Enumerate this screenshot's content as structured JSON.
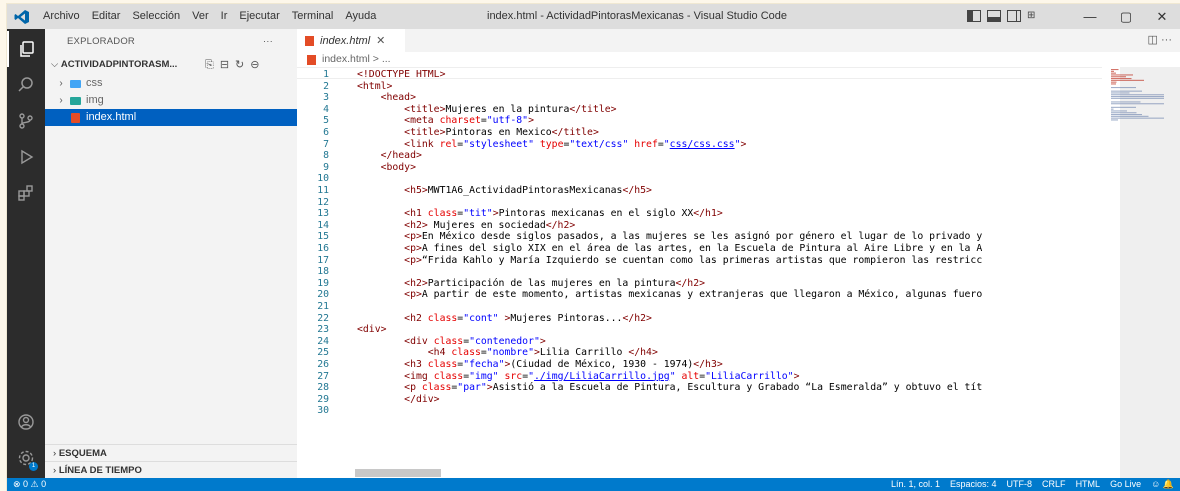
{
  "menu": [
    "Archivo",
    "Editar",
    "Selección",
    "Ver",
    "Ir",
    "Ejecutar",
    "Terminal",
    "Ayuda"
  ],
  "window_title": "index.html - ActividadPintorasMexicanas - Visual Studio Code",
  "window_controls": {
    "minimize": "—",
    "maximize": "▢",
    "close": "✕"
  },
  "sidebar": {
    "header": "EXPLORADOR",
    "more": "···",
    "project": "ACTIVIDADPINTORASM...",
    "items": [
      {
        "label": "css",
        "type": "folder",
        "color": "#42a5f5"
      },
      {
        "label": "img",
        "type": "folder",
        "color": "#26a69a"
      },
      {
        "label": "index.html",
        "type": "file"
      }
    ],
    "sections": [
      "ESQUEMA",
      "LÍNEA DE TIEMPO"
    ]
  },
  "editor": {
    "tab_label": "index.html",
    "tab_close": "✕",
    "breadcrumb": [
      "index.html",
      ">",
      "..."
    ],
    "tab_actions": "◫ ···"
  },
  "code_lines": [
    {
      "n": "1",
      "parts": [
        [
          "<!DOCTYPE HTML>",
          "t"
        ]
      ]
    },
    {
      "n": "2",
      "parts": [
        [
          "<html>",
          "t"
        ]
      ]
    },
    {
      "n": "3",
      "parts": [
        [
          "    <head>",
          "t"
        ]
      ]
    },
    {
      "n": "4",
      "parts": [
        [
          "        <title>",
          "t"
        ],
        [
          "Mujeres en la pintura",
          ""
        ],
        [
          "</title>",
          "t"
        ]
      ]
    },
    {
      "n": "5",
      "parts": [
        [
          "        <meta ",
          "t"
        ],
        [
          "charset",
          "a"
        ],
        [
          "=",
          ""
        ],
        [
          "\"utf-8\"",
          "v"
        ],
        [
          ">",
          "t"
        ]
      ]
    },
    {
      "n": "6",
      "parts": [
        [
          "        <title>",
          "t"
        ],
        [
          "Pintoras en Mexico",
          ""
        ],
        [
          "</title>",
          "t"
        ]
      ]
    },
    {
      "n": "7",
      "parts": [
        [
          "        <link ",
          "t"
        ],
        [
          "rel",
          "a"
        ],
        [
          "=",
          ""
        ],
        [
          "\"stylesheet\"",
          "v"
        ],
        [
          " ",
          ""
        ],
        [
          "type",
          "a"
        ],
        [
          "=",
          ""
        ],
        [
          "\"text/css\"",
          "v"
        ],
        [
          " ",
          ""
        ],
        [
          "href",
          "a"
        ],
        [
          "=",
          ""
        ],
        [
          "\"",
          "v"
        ],
        [
          "css/css.css",
          "u"
        ],
        [
          "\"",
          "v"
        ],
        [
          ">",
          "t"
        ]
      ]
    },
    {
      "n": "8",
      "parts": [
        [
          "    </head>",
          "t"
        ]
      ]
    },
    {
      "n": "9",
      "parts": [
        [
          "    <body>",
          "t"
        ]
      ]
    },
    {
      "n": "10",
      "parts": []
    },
    {
      "n": "11",
      "parts": [
        [
          "        <h5>",
          "t"
        ],
        [
          "MWT1A6_ActividadPintorasMexicanas",
          ""
        ],
        [
          "</h5>",
          "t"
        ]
      ]
    },
    {
      "n": "12",
      "parts": []
    },
    {
      "n": "13",
      "parts": [
        [
          "        <h1 ",
          "t"
        ],
        [
          "class",
          "a"
        ],
        [
          "=",
          ""
        ],
        [
          "\"tit\"",
          "v"
        ],
        [
          ">",
          "t"
        ],
        [
          "Pintoras mexicanas en el siglo XX",
          ""
        ],
        [
          "</h1>",
          "t"
        ]
      ]
    },
    {
      "n": "14",
      "parts": [
        [
          "        <h2>",
          "t"
        ],
        [
          " Mujeres en sociedad",
          ""
        ],
        [
          "</h2>",
          "t"
        ]
      ]
    },
    {
      "n": "15",
      "parts": [
        [
          "        <p>",
          "t"
        ],
        [
          "En México desde siglos pasados, a las mujeres se les asignó por género el lugar de lo privado y",
          ""
        ]
      ]
    },
    {
      "n": "16",
      "parts": [
        [
          "        <p>",
          "t"
        ],
        [
          "A fines del siglo XIX en el área de las artes, en la Escuela de Pintura al Aire Libre y en la A",
          ""
        ]
      ]
    },
    {
      "n": "17",
      "parts": [
        [
          "        <p>",
          "t"
        ],
        [
          "“Frida Kahlo y María Izquierdo se cuentan como las primeras artistas que rompieron las restricc",
          ""
        ]
      ]
    },
    {
      "n": "18",
      "parts": []
    },
    {
      "n": "19",
      "parts": [
        [
          "        <h2>",
          "t"
        ],
        [
          "Participación de las mujeres en la pintura",
          ""
        ],
        [
          "</h2>",
          "t"
        ]
      ]
    },
    {
      "n": "20",
      "parts": [
        [
          "        <p>",
          "t"
        ],
        [
          "A partir de este momento, artistas mexicanas y extranjeras que llegaron a México, algunas fuero",
          ""
        ]
      ]
    },
    {
      "n": "21",
      "parts": []
    },
    {
      "n": "22",
      "parts": [
        [
          "        <h2 ",
          "t"
        ],
        [
          "class",
          "a"
        ],
        [
          "=",
          ""
        ],
        [
          "\"cont\"",
          "v"
        ],
        [
          " >",
          "t"
        ],
        [
          "Mujeres Pintoras...",
          ""
        ],
        [
          "</h2>",
          "t"
        ]
      ]
    },
    {
      "n": "23",
      "parts": [
        [
          "<div>",
          "t"
        ]
      ]
    },
    {
      "n": "24",
      "parts": [
        [
          "        <div ",
          "t"
        ],
        [
          "class",
          "a"
        ],
        [
          "=",
          ""
        ],
        [
          "\"contenedor\"",
          "v"
        ],
        [
          ">",
          "t"
        ]
      ]
    },
    {
      "n": "25",
      "parts": [
        [
          "            <h4 ",
          "t"
        ],
        [
          "class",
          "a"
        ],
        [
          "=",
          ""
        ],
        [
          "\"nombre\"",
          "v"
        ],
        [
          ">",
          "t"
        ],
        [
          "Lilia Carrillo ",
          ""
        ],
        [
          "</h4>",
          "t"
        ]
      ]
    },
    {
      "n": "26",
      "parts": [
        [
          "        <h3 ",
          "t"
        ],
        [
          "class",
          "a"
        ],
        [
          "=",
          ""
        ],
        [
          "\"fecha\"",
          "v"
        ],
        [
          ">",
          "t"
        ],
        [
          "(Ciudad de México, 1930 - 1974)",
          ""
        ],
        [
          "</h3>",
          "t"
        ]
      ]
    },
    {
      "n": "27",
      "parts": [
        [
          "        <img ",
          "t"
        ],
        [
          "class",
          "a"
        ],
        [
          "=",
          ""
        ],
        [
          "\"img\"",
          "v"
        ],
        [
          " ",
          ""
        ],
        [
          "src",
          "a"
        ],
        [
          "=",
          ""
        ],
        [
          "\"",
          "v"
        ],
        [
          "./img/LiliaCarrillo.jpg",
          "u"
        ],
        [
          "\"",
          "v"
        ],
        [
          " ",
          ""
        ],
        [
          "alt",
          "a"
        ],
        [
          "=",
          ""
        ],
        [
          "\"LiliaCarrillo\"",
          "v"
        ],
        [
          ">",
          "t"
        ]
      ]
    },
    {
      "n": "28",
      "parts": [
        [
          "        <p ",
          "t"
        ],
        [
          "class",
          "a"
        ],
        [
          "=",
          ""
        ],
        [
          "\"par\"",
          "v"
        ],
        [
          ">",
          "t"
        ],
        [
          "Asistió a la Escuela de Pintura, Escultura y Grabado “La Esmeralda” y obtuvo el tít",
          ""
        ]
      ]
    },
    {
      "n": "29",
      "parts": [
        [
          "        </div>",
          "t"
        ]
      ]
    },
    {
      "n": "30",
      "parts": []
    }
  ],
  "status": {
    "left": "⊗ 0 ⚠ 0",
    "items": [
      "Lín. 1, col. 1",
      "Espacios: 4",
      "UTF-8",
      "CRLF",
      "HTML",
      "Go Live"
    ]
  }
}
